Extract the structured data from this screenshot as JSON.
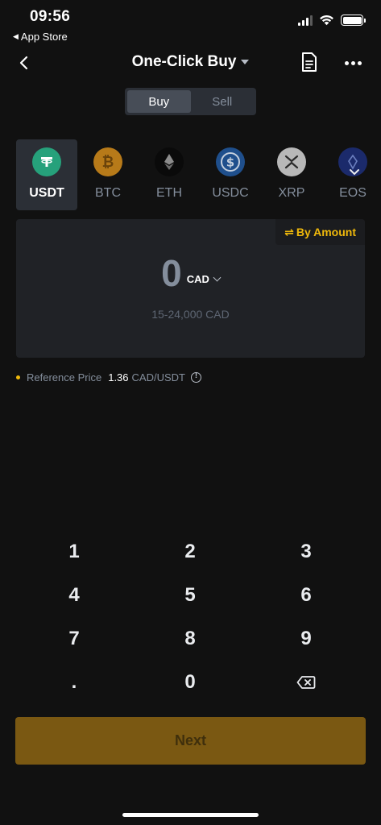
{
  "status_bar": {
    "time": "09:56",
    "back_app": "App Store"
  },
  "nav": {
    "title": "One-Click Buy"
  },
  "segment": {
    "buy": "Buy",
    "sell": "Sell",
    "selected": "Buy"
  },
  "coins": [
    {
      "label": "USDT",
      "icon": "tether-icon",
      "color": "#26a17b",
      "selected": true
    },
    {
      "label": "BTC",
      "icon": "bitcoin-icon",
      "color": "#f7931a",
      "selected": false
    },
    {
      "label": "ETH",
      "icon": "ethereum-icon",
      "color": "#1e1e1e",
      "selected": false
    },
    {
      "label": "USDC",
      "icon": "usdc-icon",
      "color": "#2775ca",
      "selected": false
    },
    {
      "label": "XRP",
      "icon": "xrp-icon",
      "color": "#c9c9c9",
      "selected": false
    },
    {
      "label": "EOS",
      "icon": "eos-icon",
      "color": "#1b2a6b",
      "selected": false
    }
  ],
  "card": {
    "mode_toggle": "By Amount",
    "amount": "0",
    "currency": "CAD",
    "range": "15-24,000 CAD"
  },
  "reference": {
    "label": "Reference Price",
    "value": "1.36",
    "unit": "CAD/USDT"
  },
  "keypad": {
    "keys": [
      "1",
      "2",
      "3",
      "4",
      "5",
      "6",
      "7",
      "8",
      "9",
      ".",
      "0",
      "backspace"
    ]
  },
  "next_label": "Next",
  "colors": {
    "accent": "#f0b90b",
    "background": "#111111",
    "next_disabled": "#7a5812"
  }
}
